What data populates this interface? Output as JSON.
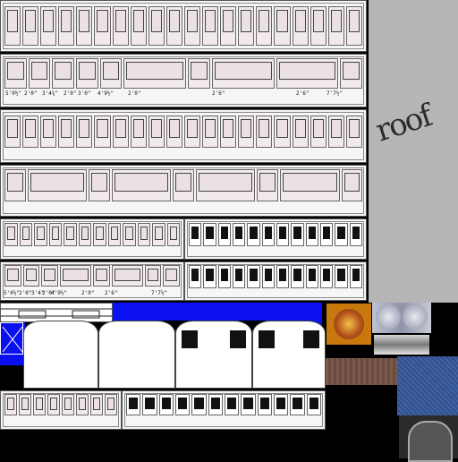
{
  "sheet": {
    "title": "",
    "roof_label": "roof",
    "dimension_labels_row2": [
      "5'0½\"",
      "2'0\"",
      "3'4¾\"",
      "2'0\"",
      "3'0\"",
      "4'9½\"",
      "2'0\"",
      "2'6\"",
      "2'6\"",
      "7'7½\""
    ],
    "dimension_labels_row6": [
      "5'0½\"",
      "2'0\"",
      "3'4\"",
      "2'0\"",
      "4'9½\"",
      "2'0\"",
      "2'6\"",
      "7'7½\""
    ]
  },
  "colors": {
    "background": "#000000",
    "roof_grey": "#b6b6b6",
    "buffer_blue": "#0a10f0",
    "crest_gold": "#c8790e",
    "coach_white": "#f6f6f6"
  },
  "icons": {
    "crest": "crest-icon",
    "lamps": "lamp-icon"
  }
}
